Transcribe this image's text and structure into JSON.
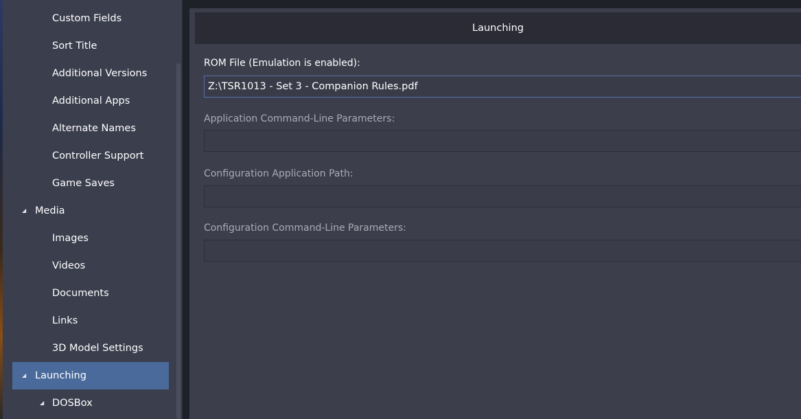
{
  "sidebar": {
    "items": [
      {
        "label": "Custom Fields",
        "level": 1,
        "expander": false,
        "selected": false
      },
      {
        "label": "Sort Title",
        "level": 1,
        "expander": false,
        "selected": false
      },
      {
        "label": "Additional Versions",
        "level": 1,
        "expander": false,
        "selected": false
      },
      {
        "label": "Additional Apps",
        "level": 1,
        "expander": false,
        "selected": false
      },
      {
        "label": "Alternate Names",
        "level": 1,
        "expander": false,
        "selected": false
      },
      {
        "label": "Controller Support",
        "level": 1,
        "expander": false,
        "selected": false
      },
      {
        "label": "Game Saves",
        "level": 1,
        "expander": false,
        "selected": false
      },
      {
        "label": "Media",
        "level": 0,
        "expander": true,
        "selected": false
      },
      {
        "label": "Images",
        "level": 1,
        "expander": false,
        "selected": false
      },
      {
        "label": "Videos",
        "level": 1,
        "expander": false,
        "selected": false
      },
      {
        "label": "Documents",
        "level": 1,
        "expander": false,
        "selected": false
      },
      {
        "label": "Links",
        "level": 1,
        "expander": false,
        "selected": false
      },
      {
        "label": "3D Model Settings",
        "level": 1,
        "expander": false,
        "selected": false
      },
      {
        "label": "Launching",
        "level": 0,
        "expander": true,
        "selected": true
      },
      {
        "label": "DOSBox",
        "level": 1,
        "expander": true,
        "selected": false
      }
    ]
  },
  "header": {
    "title": "Launching"
  },
  "form": {
    "rom_file": {
      "label": "ROM File (Emulation is enabled):",
      "value": "Z:\\TSR1013 - Set 3 - Companion Rules.pdf"
    },
    "app_params": {
      "label": "Application Command-Line Parameters:",
      "value": ""
    },
    "config_path": {
      "label": "Configuration Application Path:",
      "value": ""
    },
    "config_params": {
      "label": "Configuration Command-Line Parameters:",
      "value": ""
    }
  },
  "colors": {
    "accent_selected": "#4a6a9c",
    "panel_bg": "#3c3e4c",
    "header_bg": "#2a2b35"
  }
}
